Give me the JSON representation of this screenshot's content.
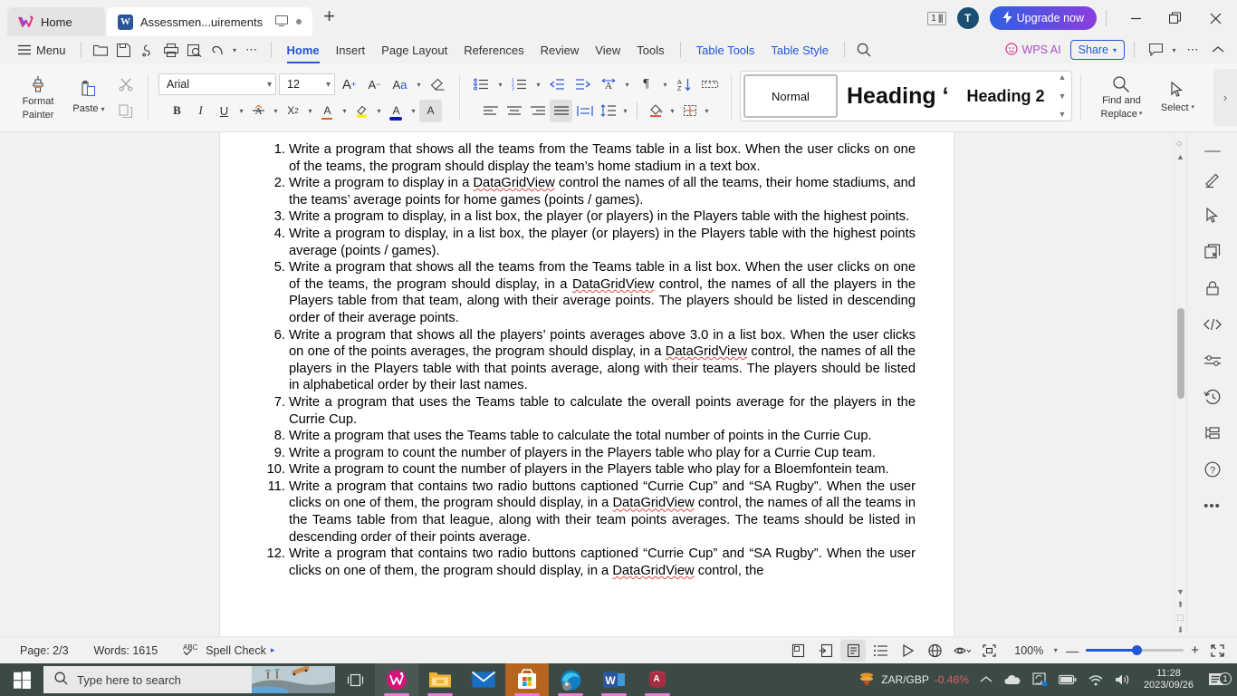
{
  "window": {
    "tabs": [
      {
        "label": "Home",
        "icon": "wps-logo-icon",
        "active": false
      },
      {
        "label": "Assessmen...uirements",
        "icon": "word-doc-icon",
        "active": true
      }
    ],
    "new_tab_label": "+",
    "page_count_badge": "1",
    "avatar_initial": "T",
    "upgrade_label": "Upgrade now",
    "minimize_label": "—",
    "restore_label": "❐",
    "close_label": "✕"
  },
  "menubar": {
    "menu_label": "Menu",
    "quick_access": [
      "open-folder-icon",
      "save-icon",
      "cloud-sync-icon",
      "print-icon",
      "print-preview-icon",
      "undo-icon",
      "more-icon"
    ],
    "ribbon_tabs": [
      {
        "label": "Home",
        "active": true
      },
      {
        "label": "Insert",
        "active": false
      },
      {
        "label": "Page Layout",
        "active": false
      },
      {
        "label": "References",
        "active": false
      },
      {
        "label": "Review",
        "active": false
      },
      {
        "label": "View",
        "active": false
      },
      {
        "label": "Tools",
        "active": false
      },
      {
        "label": "Table Tools",
        "active": false,
        "accent": true
      },
      {
        "label": "Table Style",
        "active": false,
        "accent": true
      }
    ],
    "search_icon": "search-icon",
    "wps_ai_label": "WPS AI",
    "share_label": "Share",
    "comment_icon": "comment-icon",
    "more_icon": "more-horizontal-icon",
    "collapse_icon": "chevron-up-icon"
  },
  "ribbon": {
    "format_painter_label": "Format\nPainter",
    "format_painter_line1": "Format",
    "format_painter_line2": "Painter",
    "paste_label": "Paste",
    "cut_label": "cut-icon",
    "copy_label": "copy-icon",
    "font_name": "Arial",
    "font_size": "12",
    "grow_font": "A⁺",
    "shrink_font": "A⁻",
    "change_case": "Aa",
    "clear_format": "clear-format-icon",
    "bold": "B",
    "italic": "I",
    "underline": "U",
    "strikethrough": "strikethrough-icon",
    "superscript": "X²",
    "text_effects": "A",
    "highlight": "highlight-icon",
    "font_color": "A",
    "char_shading": "A",
    "bullets": "bullet-list-icon",
    "numbering": "numbered-list-icon",
    "decrease_indent": "decrease-indent-icon",
    "increase_indent": "increase-indent-icon",
    "asian_layout": "asian-layout-icon",
    "show_marks": "¶",
    "sort": "sort-icon",
    "ruler": "ruler-icon",
    "align_left": "align-left-icon",
    "align_center": "align-center-icon",
    "align_right": "align-right-icon",
    "align_justify": "align-justify-icon",
    "distribute": "distribute-icon",
    "line_spacing": "line-spacing-icon",
    "shading": "shading-icon",
    "borders": "borders-icon",
    "styles": [
      {
        "label": "Normal",
        "selected": true,
        "size": 13,
        "weight": "normal"
      },
      {
        "label": "Heading ‘",
        "selected": false,
        "size": 24,
        "weight": "bold"
      },
      {
        "label": "Heading 2",
        "selected": false,
        "size": 18,
        "weight": "bold"
      }
    ],
    "find_replace_line1": "Find and",
    "find_replace_line2": "Replace",
    "select_label": "Select",
    "expand_icon": "chevron-right-icon"
  },
  "document": {
    "questions": [
      "Write a program that shows all the teams from the Teams table in a list box. When the user clicks on one of the teams, the program should display the team’s home stadium in a text box.",
      "Write a program to display in a DataGridView control the names of all the teams, their home stadiums, and the teams’ average points for home games (points / games).",
      "Write a program to display, in a list box, the player (or players) in the Players table with the highest points.",
      "Write a program to display, in a list box, the player (or players) in the Players table with the highest points average (points / games).",
      "Write a program that shows all the teams from the Teams table in a list box. When the user clicks on one of the teams, the program should display, in a DataGridView control, the names of all the players in the Players table from that team, along with their average points. The players should be listed in descending order of their average points.",
      "Write a program that shows all the players’ points averages above 3.0 in a list box. When the user clicks on one of the points averages, the program should display, in a DataGridView control, the names of all the players in the Players table with that points average, along with their teams. The players should be listed in alphabetical order by their last names.",
      "Write a program that uses the Teams table to calculate the overall points average for the players in the Currie Cup.",
      "Write a program that uses the Teams table to calculate the total number of points in the Currie Cup.",
      "Write a program to count the number of players in the Players table who play for a Currie Cup team.",
      "Write a program to count the number of players in the Players table who play for a Bloemfontein team.",
      "Write a program that contains two radio buttons captioned “Currie Cup” and “SA Rugby”. When the user clicks on one of them, the program should display, in a DataGridView control, the names of all the teams in the Teams table from that league, along with their team points averages. The teams should be listed in descending order of their points average.",
      "Write a program that contains two radio buttons captioned “Currie Cup” and “SA Rugby”. When the user clicks on one of them, the program should display, in a DataGridView control, the"
    ]
  },
  "rail": {
    "items": [
      "pen-highlighter-icon",
      "cursor-select-icon",
      "close-window-icon",
      "lock-icon",
      "code-icon",
      "settings-sliders-icon",
      "history-clock-icon",
      "outline-tree-icon",
      "help-question-icon",
      "more-dots-icon"
    ]
  },
  "statusbar": {
    "page_label": "Page: 2/3",
    "words_label": "Words: 1615",
    "spell_check_label": "Spell Check",
    "spell_check_icon": "abc-check-icon",
    "spell_check_arrow": "▸",
    "view_icons": [
      "page-view-icon",
      "web-layout-icon",
      "read-mode-icon",
      "outline-view-icon",
      "presentation-icon",
      "web-globe-icon",
      "eye-visibility-icon",
      "focus-mode-icon"
    ],
    "zoom_level": "100%",
    "zoom_out": "—",
    "zoom_in": "+",
    "fullscreen_icon": "fullscreen-icon"
  },
  "taskbar": {
    "start_icon": "windows-start-icon",
    "search_placeholder": "Type here to search",
    "task_view_icon": "task-view-icon",
    "apps": [
      {
        "name": "wps-office-taskbar-icon",
        "label": "WPS Office"
      },
      {
        "name": "file-explorer-taskbar-icon",
        "label": "File Explorer"
      },
      {
        "name": "mail-taskbar-icon",
        "label": "Mail"
      },
      {
        "name": "microsoft-store-taskbar-icon",
        "label": "Microsoft Store"
      },
      {
        "name": "edge-taskbar-icon",
        "label": "Microsoft Edge"
      },
      {
        "name": "word-taskbar-icon",
        "label": "Word"
      },
      {
        "name": "access-taskbar-icon",
        "label": "Access"
      }
    ],
    "tray": {
      "stock_label": "ZAR/GBP",
      "stock_change": "-0.46%",
      "stock_change_color": "#e06060",
      "chevron": "∧",
      "onedrive_icon": "onedrive-icon",
      "sync_icon": "sync-icon",
      "battery_icon": "battery-icon",
      "wifi_icon": "wifi-icon",
      "volume_icon": "volume-icon",
      "time": "11:28",
      "date": "2023/09/26",
      "notification_count": "1"
    }
  },
  "colors": {
    "accent": "#2457d6",
    "ai_accent": "#b44ad0",
    "taskbar_bg": "#3c4a45",
    "ribbon_bg": "#f6f6f6",
    "chrome_bg": "#f1f1f1"
  }
}
